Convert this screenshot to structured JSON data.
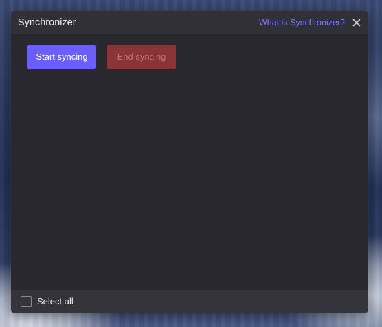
{
  "dialog": {
    "title": "Synchronizer",
    "help_link": "What is Synchronizer?",
    "close_icon": "close-icon"
  },
  "toolbar": {
    "start_label": "Start syncing",
    "end_label": "End syncing",
    "end_disabled": true
  },
  "footer": {
    "select_all_label": "Select all",
    "select_all_checked": false
  },
  "colors": {
    "accent": "#6a5ffd",
    "danger": "#8a3438",
    "link": "#7f76ff",
    "dialog_bg": "#29282e"
  }
}
